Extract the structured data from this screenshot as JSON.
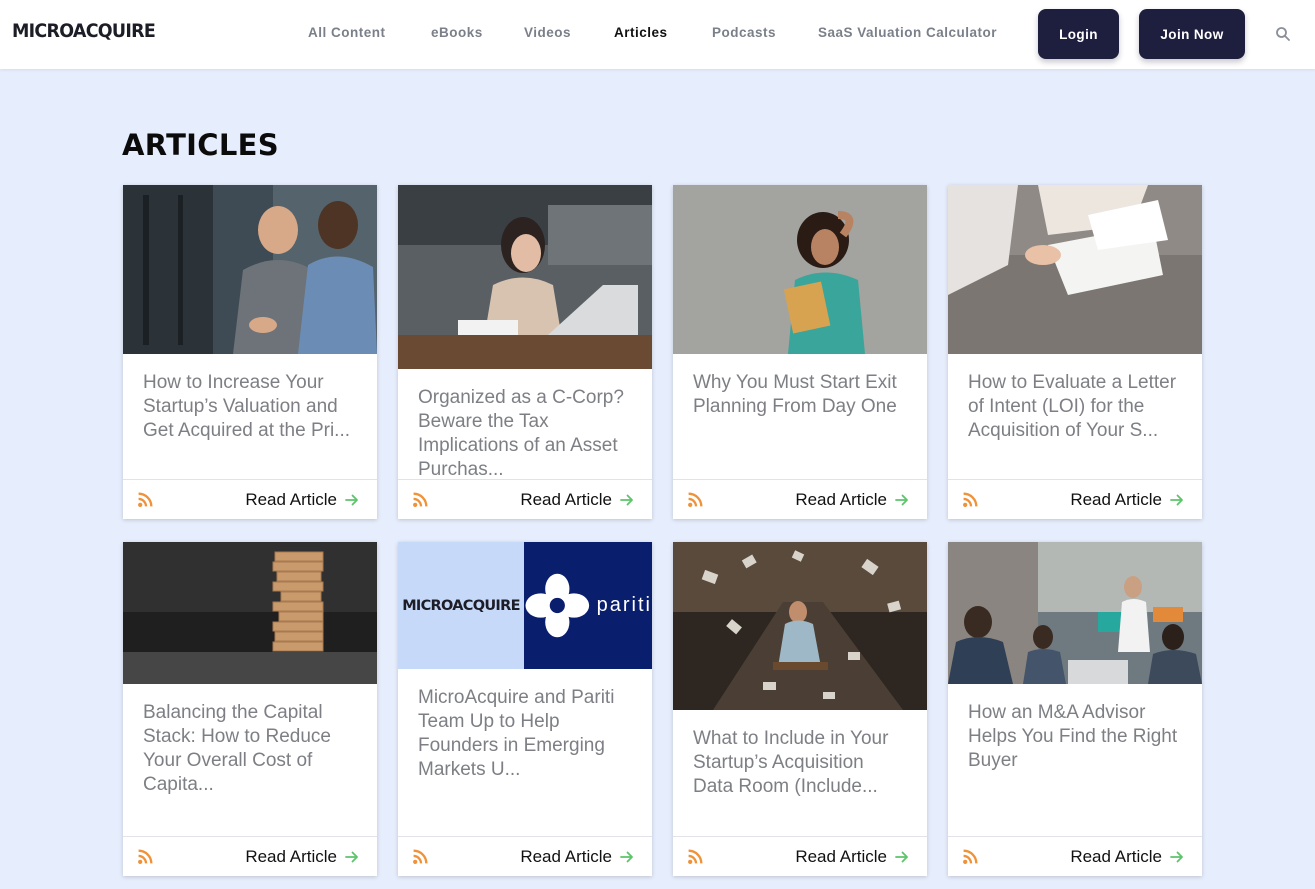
{
  "header": {
    "logo": "MICROACQUIRE",
    "nav": [
      "All Content",
      "eBooks",
      "Videos",
      "Articles",
      "Podcasts",
      "SaaS Valuation Calculator"
    ],
    "active_nav": "Articles",
    "login_label": "Login",
    "join_label": "Join Now"
  },
  "page": {
    "title": "ARTICLES"
  },
  "colors": {
    "brand_navy": "#1e1e3e",
    "background": "#e6edfc",
    "rss_orange": "#f0923a",
    "arrow_green": "#5cc46a"
  },
  "card_link_label": "Read Article",
  "cards": [
    {
      "title": "How to Increase Your Startup’s Valuation and Get Acquired at the Pri..."
    },
    {
      "title": "Organized as a C-Corp? Beware the Tax Implications of an Asset Purchas..."
    },
    {
      "title": "Why You Must Start Exit Planning From Day One"
    },
    {
      "title": "How to Evaluate a Letter of Intent (LOI) for the Acquisition of Your S..."
    },
    {
      "title": "Balancing the Capital Stack: How to Reduce Your Overall Cost of Capita..."
    },
    {
      "title": "MicroAcquire and Pariti Team Up to Help Founders in Emerging Markets U..."
    },
    {
      "title": "What to Include in Your Startup’s Acquisition Data Room (Include..."
    },
    {
      "title": "How an M&A Advisor Helps You Find the Right Buyer"
    }
  ],
  "partner_image": {
    "left_text": "MICROACQUIRE",
    "right_text": "pariti"
  }
}
